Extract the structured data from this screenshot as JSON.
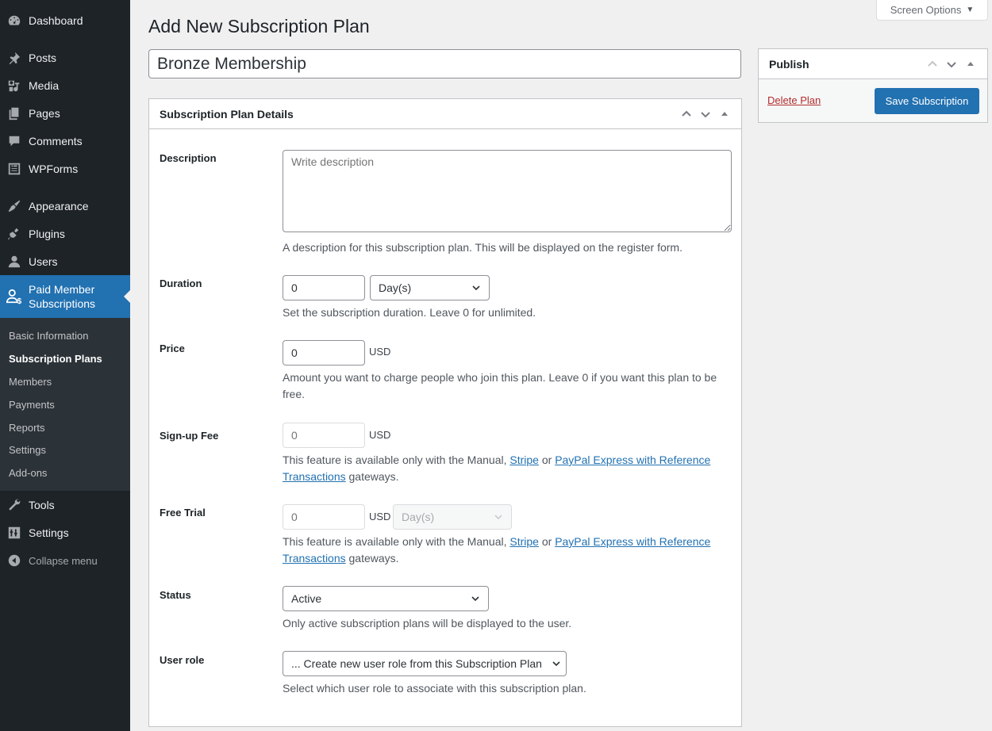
{
  "sidebar": {
    "items": [
      {
        "label": "Dashboard",
        "icon": "dashboard-icon"
      },
      {
        "label": "Posts",
        "icon": "pin-icon"
      },
      {
        "label": "Media",
        "icon": "media-icon"
      },
      {
        "label": "Pages",
        "icon": "pages-icon"
      },
      {
        "label": "Comments",
        "icon": "comment-icon"
      },
      {
        "label": "WPForms",
        "icon": "forms-icon"
      },
      {
        "label": "Appearance",
        "icon": "brush-icon"
      },
      {
        "label": "Plugins",
        "icon": "plugin-icon"
      },
      {
        "label": "Users",
        "icon": "user-icon"
      }
    ],
    "active": {
      "label_line1": "Paid Member",
      "label_line2": "Subscriptions",
      "icon": "member-dollar-icon"
    },
    "submenu": [
      "Basic Information",
      "Subscription Plans",
      "Members",
      "Payments",
      "Reports",
      "Settings",
      "Add-ons"
    ],
    "submenu_current": "Subscription Plans",
    "bottom_items": [
      {
        "label": "Tools",
        "icon": "wrench-icon"
      },
      {
        "label": "Settings",
        "icon": "settings-icon"
      }
    ],
    "collapse_label": "Collapse menu"
  },
  "screen_options": {
    "label": "Screen Options",
    "arrow": "▼"
  },
  "page_title": "Add New Subscription Plan",
  "title_input": {
    "value": "Bronze Membership"
  },
  "details_box": {
    "title": "Subscription Plan Details",
    "description": {
      "label": "Description",
      "placeholder": "Write description",
      "help": "A description for this subscription plan. This will be displayed on the register form."
    },
    "duration": {
      "label": "Duration",
      "value": "0",
      "unit": "Day(s)",
      "help": "Set the subscription duration. Leave 0 for unlimited."
    },
    "price": {
      "label": "Price",
      "value": "0",
      "currency": "USD",
      "help": "Amount you want to charge people who join this plan. Leave 0 if you want this plan to be free."
    },
    "signup_fee": {
      "label": "Sign-up Fee",
      "placeholder": "0",
      "currency": "USD",
      "help_prefix": "This feature is available only with the Manual, ",
      "link1": "Stripe",
      "help_mid": " or ",
      "link2": "PayPal Express with Reference Transactions",
      "help_suffix": " gateways."
    },
    "free_trial": {
      "label": "Free Trial",
      "placeholder": "0",
      "currency": "USD",
      "unit": "Day(s)",
      "help_prefix": "This feature is available only with the Manual, ",
      "link1": "Stripe",
      "help_mid": " or ",
      "link2": "PayPal Express with Reference Transactions",
      "help_suffix": " gateways."
    },
    "status": {
      "label": "Status",
      "value": "Active",
      "help": "Only active subscription plans will be displayed to the user."
    },
    "user_role": {
      "label": "User role",
      "value": "... Create new user role from this Subscription Plan",
      "help": "Select which user role to associate with this subscription plan."
    }
  },
  "publish_box": {
    "title": "Publish",
    "delete_label": "Delete Plan",
    "save_label": "Save Subscription"
  },
  "colors": {
    "accent": "#2271b1",
    "sidebar_bg": "#1d2327",
    "submenu_bg": "#2c3338",
    "delete": "#b32d2e"
  }
}
